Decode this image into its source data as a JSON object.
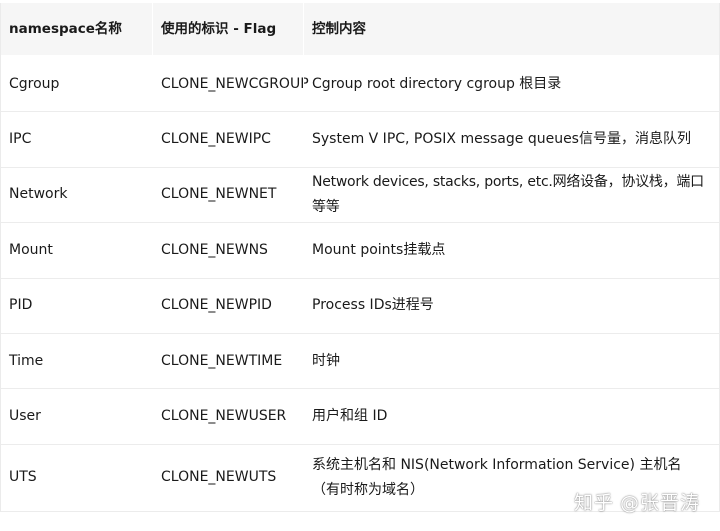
{
  "table": {
    "headers": [
      "namespace名称",
      "使用的标识 - Flag",
      "控制内容"
    ],
    "rows": [
      {
        "name": "Cgroup",
        "flag": "CLONE_NEWCGROUP",
        "content": "Cgroup root directory cgroup 根目录"
      },
      {
        "name": "IPC",
        "flag": "CLONE_NEWIPC",
        "content": "System V IPC, POSIX message queues信号量，消息队列"
      },
      {
        "name": "Network",
        "flag": "CLONE_NEWNET",
        "content": "Network devices, stacks, ports, etc.网络设备，协议栈，端口等等"
      },
      {
        "name": "Mount",
        "flag": "CLONE_NEWNS",
        "content": "Mount points挂载点"
      },
      {
        "name": "PID",
        "flag": "CLONE_NEWPID",
        "content": "Process IDs进程号"
      },
      {
        "name": "Time",
        "flag": "CLONE_NEWTIME",
        "content": "时钟"
      },
      {
        "name": "User",
        "flag": "CLONE_NEWUSER",
        "content": "用户和组 ID"
      },
      {
        "name": "UTS",
        "flag": "CLONE_NEWUTS",
        "content": "系统主机名和 NIS(Network Information Service) 主机名（有时称为域名）"
      }
    ]
  },
  "watermark": {
    "site": "知乎",
    "author": "@张晋涛"
  }
}
